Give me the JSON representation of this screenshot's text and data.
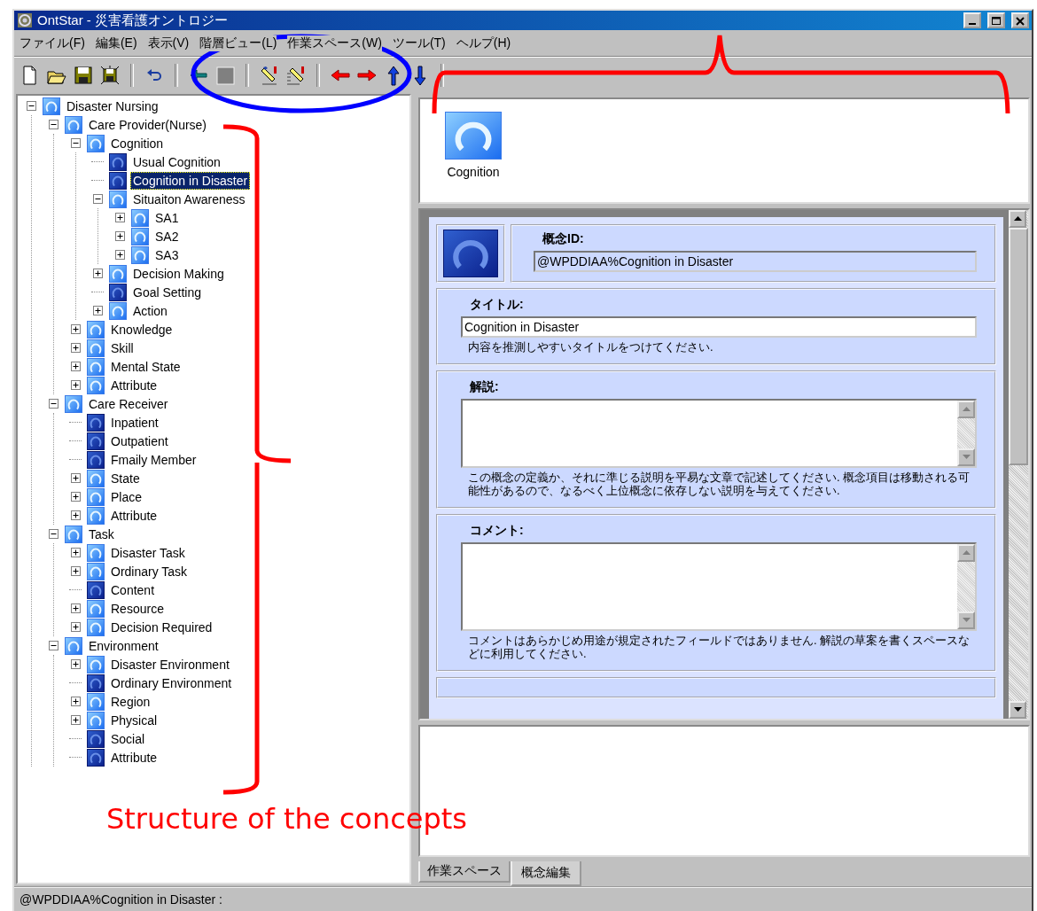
{
  "window": {
    "title": "OntStar - 災害看護オントロジー"
  },
  "menu": [
    "ファイル(F)",
    "編集(E)",
    "表示(V)",
    "階層ビュー(L)",
    "作業スペース(W)",
    "ツール(T)",
    "ヘルプ(H)"
  ],
  "toolbar": [
    {
      "kind": "new"
    },
    {
      "kind": "open"
    },
    {
      "kind": "save"
    },
    {
      "kind": "save-all"
    },
    {
      "kind": "separator"
    },
    {
      "kind": "undo"
    },
    {
      "kind": "separator"
    },
    {
      "kind": "back"
    },
    {
      "kind": "stop"
    },
    {
      "kind": "separator"
    },
    {
      "kind": "edit"
    },
    {
      "kind": "edit-list"
    },
    {
      "kind": "separator"
    },
    {
      "kind": "left"
    },
    {
      "kind": "right"
    },
    {
      "kind": "up"
    },
    {
      "kind": "down"
    },
    {
      "kind": "separator"
    }
  ],
  "tree": [
    {
      "label": "Disaster Nursing",
      "selected": false,
      "expanded": true,
      "children": [
        {
          "label": "Care Provider(Nurse)",
          "selected": false,
          "expanded": true,
          "children": [
            {
              "label": "Cognition",
              "selected": false,
              "expanded": true,
              "children": [
                {
                  "label": "Usual Cognition",
                  "selected": false
                },
                {
                  "label": "Cognition in Disaster",
                  "selected": true
                },
                {
                  "label": "Situaiton Awareness",
                  "selected": false,
                  "expanded": true,
                  "children": [
                    {
                      "label": "SA1",
                      "selected": false,
                      "expanded": false
                    },
                    {
                      "label": "SA2",
                      "selected": false,
                      "expanded": false
                    },
                    {
                      "label": "SA3",
                      "selected": false,
                      "expanded": false
                    }
                  ]
                },
                {
                  "label": "Decision Making",
                  "selected": false,
                  "expanded": false
                },
                {
                  "label": "Goal Setting",
                  "selected": false
                },
                {
                  "label": "Action",
                  "selected": false,
                  "expanded": false
                }
              ]
            },
            {
              "label": "Knowledge",
              "selected": false,
              "expanded": false
            },
            {
              "label": "Skill",
              "selected": false,
              "expanded": false
            },
            {
              "label": "Mental State",
              "selected": false,
              "expanded": false
            },
            {
              "label": "Attribute",
              "selected": false,
              "expanded": false
            }
          ]
        },
        {
          "label": "Care Receiver",
          "selected": false,
          "expanded": true,
          "children": [
            {
              "label": "Inpatient",
              "selected": false
            },
            {
              "label": "Outpatient",
              "selected": false
            },
            {
              "label": "Fmaily Member",
              "selected": false
            },
            {
              "label": "State",
              "selected": false,
              "expanded": false
            },
            {
              "label": "Place",
              "selected": false,
              "expanded": false
            },
            {
              "label": "Attribute",
              "selected": false,
              "expanded": false
            }
          ]
        },
        {
          "label": "Task",
          "selected": false,
          "expanded": true,
          "children": [
            {
              "label": "Disaster Task",
              "selected": false,
              "expanded": false
            },
            {
              "label": "Ordinary Task",
              "selected": false,
              "expanded": false
            },
            {
              "label": "Content",
              "selected": false
            },
            {
              "label": "Resource",
              "selected": false,
              "expanded": false
            },
            {
              "label": "Decision Required",
              "selected": false,
              "expanded": false
            }
          ]
        },
        {
          "label": "Environment",
          "selected": false,
          "expanded": true,
          "children": [
            {
              "label": "Disaster Environment",
              "selected": false,
              "expanded": false
            },
            {
              "label": "Ordinary Environment",
              "selected": false
            },
            {
              "label": "Region",
              "selected": false,
              "expanded": false
            },
            {
              "label": "Physical",
              "selected": false,
              "expanded": false
            },
            {
              "label": "Social",
              "selected": false
            },
            {
              "label": "Attribute",
              "selected": false
            }
          ]
        }
      ]
    }
  ],
  "preview": {
    "label": "Cognition"
  },
  "form": {
    "id_label": "概念ID:",
    "id_value": "@WPDDIAA%Cognition in Disaster",
    "sections": [
      {
        "kind": "line",
        "label": "タイトル:",
        "value": "Cognition in Disaster",
        "hint": "内容を推測しやすいタイトルをつけてください."
      },
      {
        "kind": "area",
        "label": "解説:",
        "hint": "この概念の定義か、それに準じる説明を平易な文章で記述してください. 概念項目は移動される可能性があるので、なるべく上位概念に依存しない説明を与えてください."
      },
      {
        "kind": "area",
        "label": "コメント:",
        "hint": "コメントはあらかじめ用途が規定されたフィールドではありません. 解説の草案を書くスペースなどに利用してください."
      }
    ]
  },
  "tabs": [
    {
      "label": "作業スペース",
      "selected": false
    },
    {
      "label": "概念編集",
      "selected": true
    }
  ],
  "status_bar": "@WPDDIAA%Cognition in Disaster :",
  "annotations": {
    "captions": [
      {
        "text": "Structure of the concepts",
        "color": "#ff0000"
      }
    ],
    "marks": [
      {
        "kind": "ellipse",
        "color": "#0000ff"
      },
      {
        "kind": "brace-top",
        "color": "#ff0000"
      },
      {
        "kind": "brace-left",
        "color": "#ff0000"
      }
    ]
  }
}
